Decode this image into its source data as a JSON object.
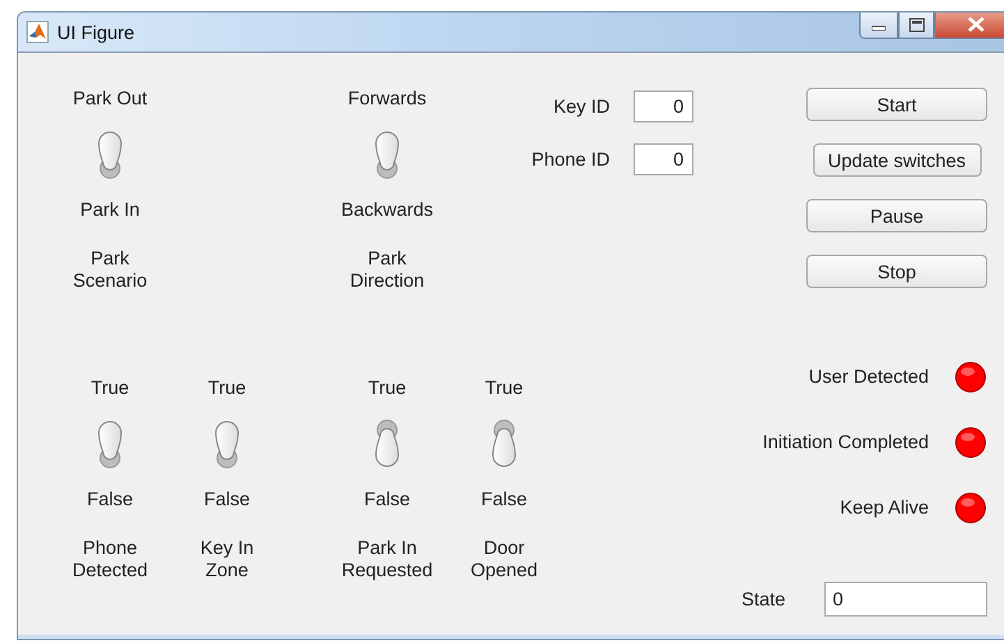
{
  "window": {
    "title": "UI Figure"
  },
  "top_switches": [
    {
      "top_label": "Park Out",
      "bottom_label": "Park In",
      "name": "Park\nScenario",
      "on": true
    },
    {
      "top_label": "Forwards",
      "bottom_label": "Backwards",
      "name": "Park\nDirection",
      "on": true
    }
  ],
  "fields": [
    {
      "label": "Key ID",
      "value": "0"
    },
    {
      "label": "Phone ID",
      "value": "0"
    }
  ],
  "buttons": [
    "Start",
    "Update switches",
    "Pause",
    "Stop"
  ],
  "bottom_switches": [
    {
      "top_label": "True",
      "bottom_label": "False",
      "name": "Phone\nDetected",
      "on": true
    },
    {
      "top_label": "True",
      "bottom_label": "False",
      "name": "Key In\nZone",
      "on": true
    },
    {
      "top_label": "True",
      "bottom_label": "False",
      "name": "Park In\nRequested",
      "on": false
    },
    {
      "top_label": "True",
      "bottom_label": "False",
      "name": "Door\nOpened",
      "on": false
    }
  ],
  "lamps": [
    {
      "label": "User Detected",
      "color": "#ff0000"
    },
    {
      "label": "Initiation Completed",
      "color": "#ff0000"
    },
    {
      "label": "Keep Alive",
      "color": "#ff0000"
    }
  ],
  "state": {
    "label": "State",
    "value": "0"
  }
}
